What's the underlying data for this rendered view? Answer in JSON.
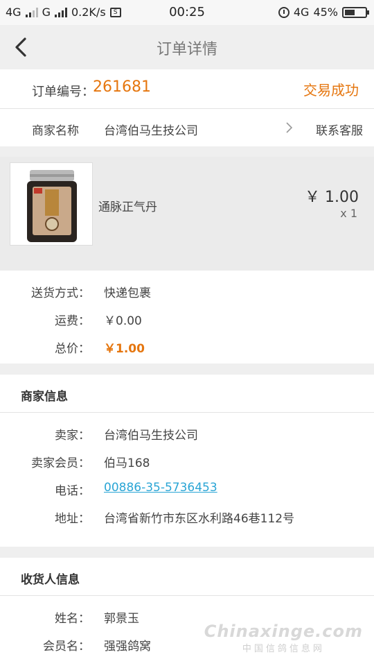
{
  "status_bar": {
    "net1": "4G",
    "net2": "G",
    "speed": "0.2K/s",
    "time": "00:25",
    "net3": "4G",
    "battery": "45%"
  },
  "nav": {
    "title": "订单详情",
    "back_icon": "chevron-left-icon"
  },
  "order": {
    "number_label": "订单编号：",
    "number": "261681",
    "status": "交易成功"
  },
  "merchant": {
    "label": "商家名称",
    "name": "台湾伯马生技公司",
    "contact": "联系客服"
  },
  "product": {
    "name": "通脉正气丹",
    "price": "￥ 1.00",
    "quantity": "x 1"
  },
  "delivery": {
    "method_label": "送货方式：",
    "method": "快递包裹",
    "shipping_label": "运费：",
    "shipping": "￥0.00",
    "total_label": "总价：",
    "total": "￥1.00"
  },
  "seller_info": {
    "title": "商家信息",
    "seller_label": "卖家：",
    "seller": "台湾伯马生技公司",
    "member_label": "卖家会员：",
    "member": "伯马168",
    "phone_label": "电话：",
    "phone": "00886-35-5736453",
    "address_label": "地址：",
    "address": "台湾省新竹市东区水利路46巷112号"
  },
  "receiver_info": {
    "title": "收货人信息",
    "name_label": "姓名：",
    "name": "郭景玉",
    "member_label": "会员名：",
    "member": "强强鸽窝"
  },
  "watermark": {
    "main": "Chinaxinge.com",
    "sub": "中国信鸽信息网"
  },
  "colors": {
    "accent": "#e5760f",
    "link": "#2aa5d5"
  }
}
